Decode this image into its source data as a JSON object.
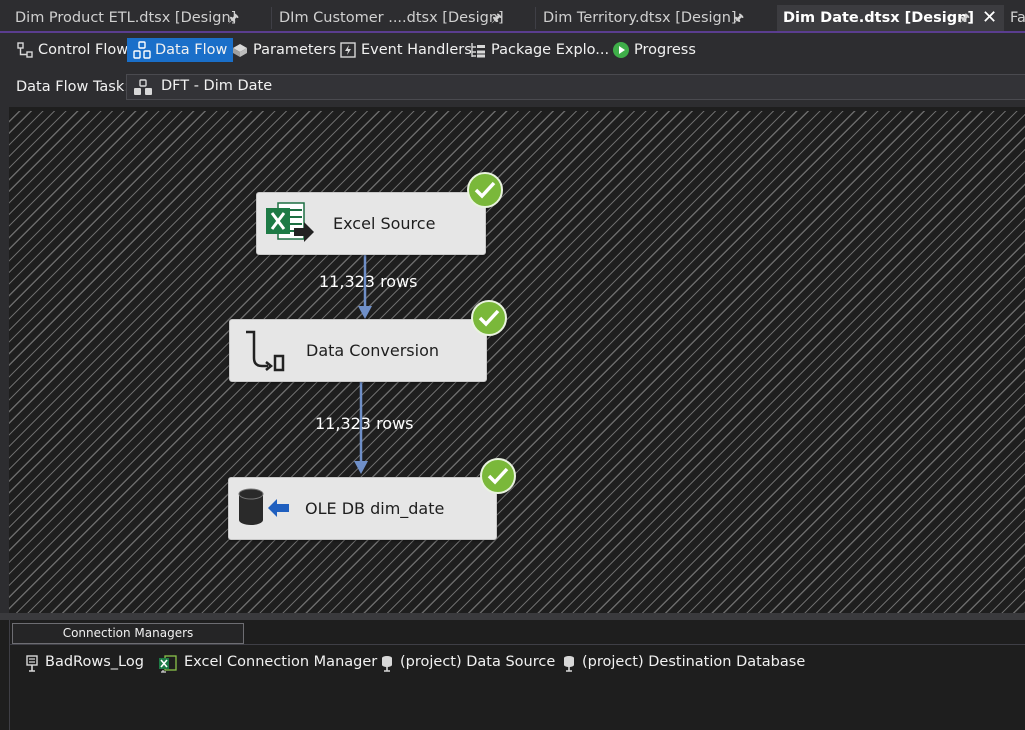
{
  "tabs": [
    {
      "label": "Dim Product ETL.dtsx [Design]"
    },
    {
      "label": "DIm Customer ....dtsx [Design]"
    },
    {
      "label": "Dim Territory.dtsx [Design]"
    },
    {
      "label": "Dim Date.dtsx [Design]",
      "active": true
    },
    {
      "label": "Fa"
    }
  ],
  "designer_tabs": [
    {
      "label": "Control Flow",
      "icon": "control-flow-icon"
    },
    {
      "label": "Data Flow",
      "icon": "data-flow-icon",
      "active": true
    },
    {
      "label": "Parameters",
      "icon": "parameters-icon"
    },
    {
      "label": "Event Handlers",
      "icon": "event-handlers-icon"
    },
    {
      "label": "Package Explo...",
      "icon": "package-explorer-icon"
    },
    {
      "label": "Progress",
      "icon": "progress-icon"
    }
  ],
  "task": {
    "label": "Data Flow Task:",
    "value": "DFT - Dim Date"
  },
  "components": [
    {
      "name": "Excel Source",
      "icon": "excel-source-icon",
      "status": "success"
    },
    {
      "name": "Data Conversion",
      "icon": "data-conversion-icon",
      "status": "success"
    },
    {
      "name": "OLE DB dim_date",
      "icon": "oledb-destination-icon",
      "status": "success"
    }
  ],
  "paths": [
    {
      "label": "11,323 rows"
    },
    {
      "label": "11,323 rows"
    }
  ],
  "connection_managers": {
    "tab_label": "Connection Managers",
    "items": [
      {
        "label": "BadRows_Log",
        "icon": "flat-file-connection-icon"
      },
      {
        "label": "Excel Connection Manager",
        "icon": "excel-connection-icon"
      },
      {
        "label": "(project) Data Source",
        "icon": "project-connection-icon"
      },
      {
        "label": "(project) Destination Database",
        "icon": "project-connection-icon"
      }
    ]
  },
  "colors": {
    "accent": "#1a6fc9",
    "success": "#7ab83a",
    "active_tab_border": "#5a3d8f"
  }
}
